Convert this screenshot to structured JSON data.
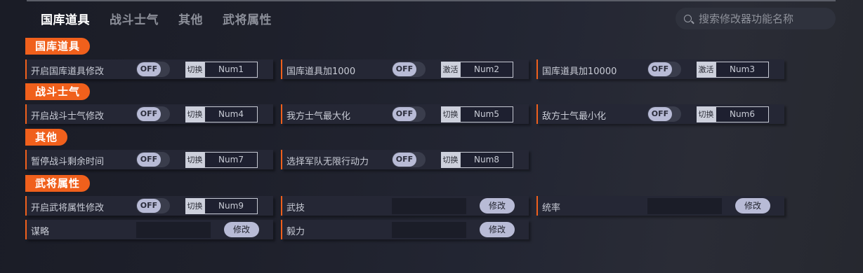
{
  "tabs": [
    {
      "label": "国库道具",
      "active": true
    },
    {
      "label": "战斗士气",
      "active": false
    },
    {
      "label": "其他",
      "active": false
    },
    {
      "label": "武将属性",
      "active": false
    }
  ],
  "search": {
    "placeholder": "搜索修改器功能名称"
  },
  "sections": {
    "treasury": {
      "title": "国库道具",
      "items": [
        {
          "label": "开启国库道具修改",
          "toggle": "OFF",
          "key_type": "切换",
          "key": "Num1"
        },
        {
          "label": "国库道具加1000",
          "toggle": "OFF",
          "key_type": "激活",
          "key": "Num2"
        },
        {
          "label": "国库道具加10000",
          "toggle": "OFF",
          "key_type": "激活",
          "key": "Num3"
        }
      ]
    },
    "morale": {
      "title": "战斗士气",
      "items": [
        {
          "label": "开启战斗士气修改",
          "toggle": "OFF",
          "key_type": "切换",
          "key": "Num4"
        },
        {
          "label": "我方士气最大化",
          "toggle": "OFF",
          "key_type": "切换",
          "key": "Num5"
        },
        {
          "label": "敌方士气最小化",
          "toggle": "OFF",
          "key_type": "切换",
          "key": "Num6"
        }
      ]
    },
    "other": {
      "title": "其他",
      "items": [
        {
          "label": "暂停战斗剩余时间",
          "toggle": "OFF",
          "key_type": "切换",
          "key": "Num7"
        },
        {
          "label": "选择军队无限行动力",
          "toggle": "OFF",
          "key_type": "切换",
          "key": "Num8"
        }
      ]
    },
    "general": {
      "title": "武将属性",
      "items": [
        {
          "label": "开启武将属性修改",
          "toggle": "OFF",
          "key_type": "切换",
          "key": "Num9"
        },
        {
          "label": "武技",
          "button": "修改"
        },
        {
          "label": "统率",
          "button": "修改"
        },
        {
          "label": "谋略",
          "button": "修改"
        },
        {
          "label": "毅力",
          "button": "修改"
        }
      ]
    }
  },
  "colors": {
    "accent": "#f0601c",
    "card_bg": "#252735",
    "toggle_knob": "#b8bbd6"
  }
}
